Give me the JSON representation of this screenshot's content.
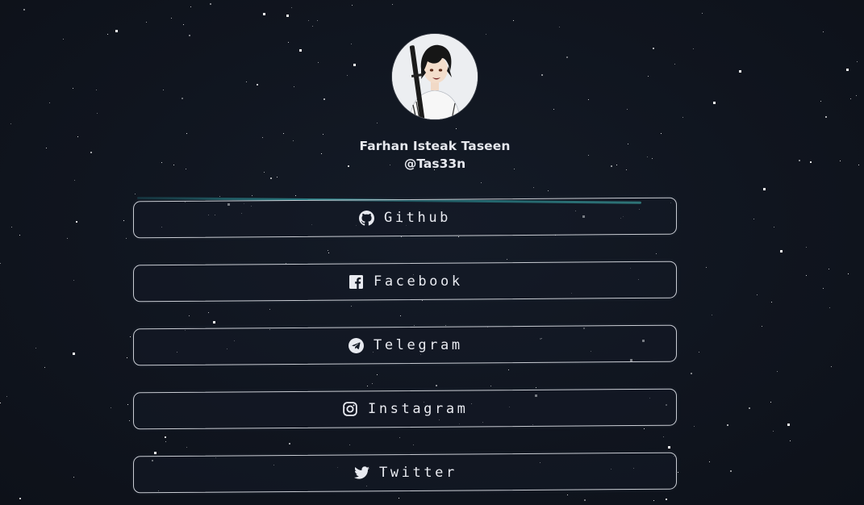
{
  "profile": {
    "name": "Farhan Isteak Taseen",
    "handle": "@Tas33n"
  },
  "links": [
    {
      "label": "Github",
      "icon": "github-icon"
    },
    {
      "label": "Facebook",
      "icon": "facebook-icon"
    },
    {
      "label": "Telegram",
      "icon": "telegram-icon"
    },
    {
      "label": "Instagram",
      "icon": "instagram-icon"
    },
    {
      "label": "Twitter",
      "icon": "twitter-icon"
    }
  ],
  "colors": {
    "background": "#10151f",
    "border": "#c9ccd3",
    "accent": "#38c4c6",
    "text": "#e8eaf0"
  }
}
